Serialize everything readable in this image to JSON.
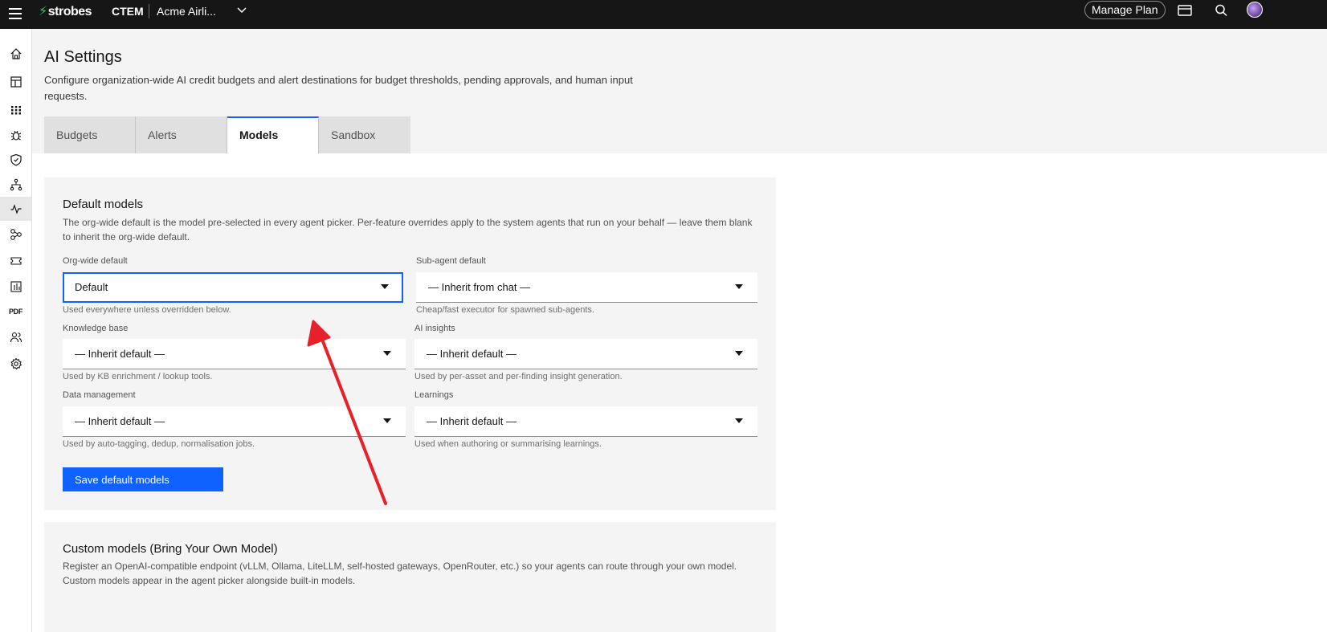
{
  "topbar": {
    "logo": "strobes",
    "product": "CTEM",
    "org_name": "Acme Airli...",
    "manage_plan": "Manage Plan"
  },
  "siderail": {
    "items": [
      "home-icon",
      "dashboard-icon",
      "apps-grid-icon",
      "bug-icon",
      "shield-check-icon",
      "network-icon",
      "activity-icon",
      "integrations-icon",
      "ticket-icon",
      "reports-icon",
      "pdf-icon",
      "users-icon",
      "settings-icon"
    ],
    "pdf_label": "PDF"
  },
  "page": {
    "title": "AI Settings",
    "description": "Configure organization-wide AI credit budgets and alert destinations for budget thresholds, pending approvals, and human input requests."
  },
  "tabs": [
    {
      "label": "Budgets",
      "active": false
    },
    {
      "label": "Alerts",
      "active": false
    },
    {
      "label": "Models",
      "active": true
    },
    {
      "label": "Sandbox",
      "active": false
    }
  ],
  "default_models": {
    "title": "Default models",
    "description": "The org-wide default is the model pre-selected in every agent picker. Per-feature overrides apply to the system agents that run on your behalf — leave them blank to inherit the org-wide default.",
    "fields": {
      "org_wide": {
        "label": "Org-wide default",
        "value": "Default",
        "helper": "Used everywhere unless overridden below."
      },
      "sub_agent": {
        "label": "Sub-agent default",
        "value": "— Inherit from chat —",
        "helper": "Cheap/fast executor for spawned sub-agents."
      },
      "knowledge_base": {
        "label": "Knowledge base",
        "value": "— Inherit default —",
        "helper": "Used by KB enrichment / lookup tools."
      },
      "ai_insights": {
        "label": "AI insights",
        "value": "— Inherit default —",
        "helper": "Used by per-asset and per-finding insight generation."
      },
      "data_management": {
        "label": "Data management",
        "value": "— Inherit default —",
        "helper": "Used by auto-tagging, dedup, normalisation jobs."
      },
      "learnings": {
        "label": "Learnings",
        "value": "— Inherit default —",
        "helper": "Used when authoring or summarising learnings."
      }
    },
    "save_label": "Save default models"
  },
  "custom_models": {
    "title": "Custom models (Bring Your Own Model)",
    "description": "Register an OpenAI-compatible endpoint (vLLM, Ollama, LiteLLM, self-hosted gateways, OpenRouter, etc.) so your agents can route through your own model. Custom models appear in the agent picker alongside built-in models."
  },
  "colors": {
    "accent": "#0f62fe",
    "annotation_arrow": "#e8202a",
    "topbar": "#161616"
  }
}
